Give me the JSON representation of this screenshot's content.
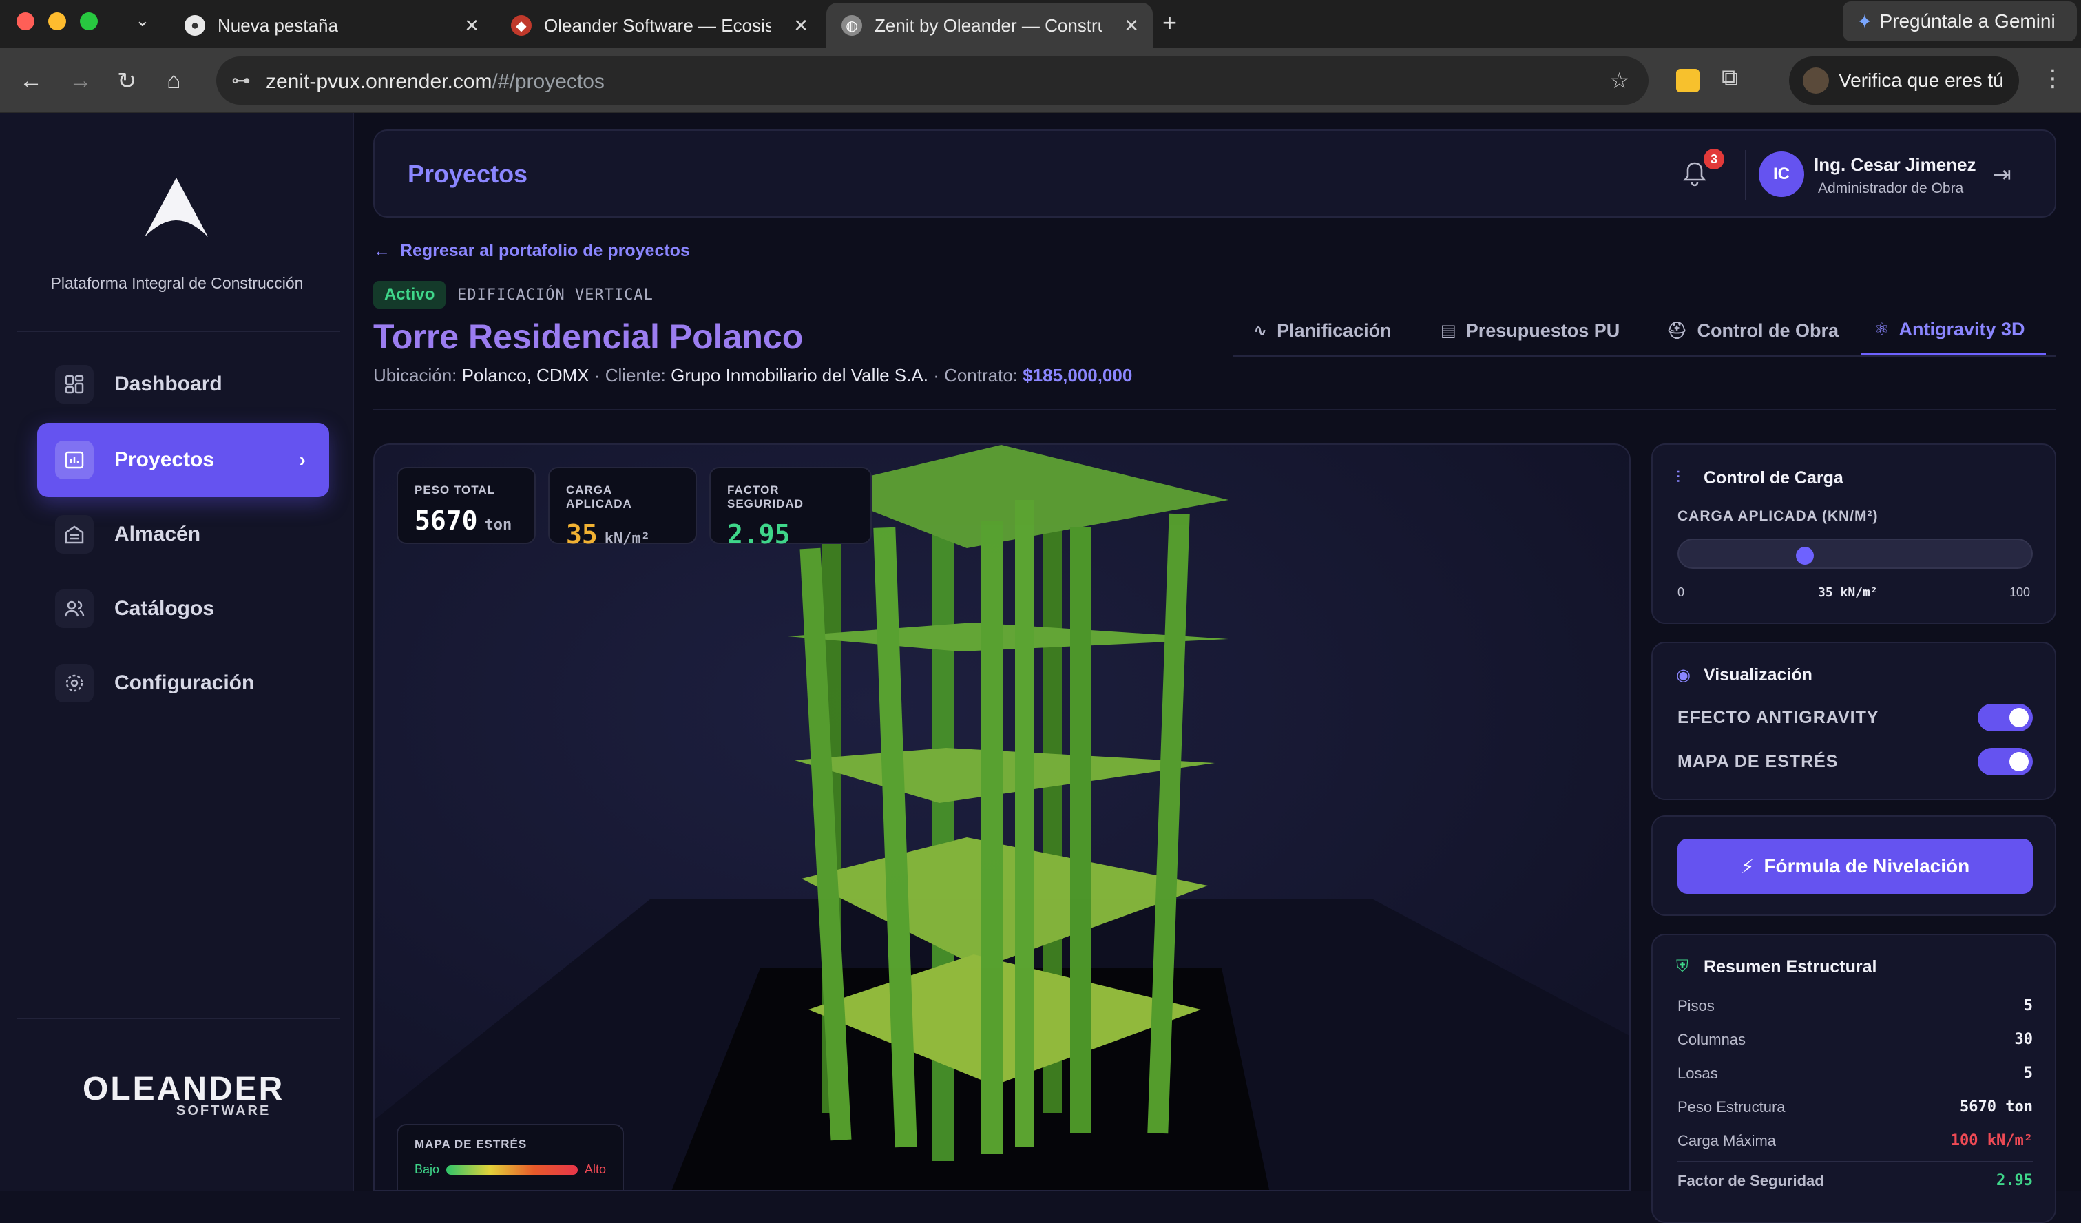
{
  "browser": {
    "tabs": [
      {
        "title": "Nueva pestaña"
      },
      {
        "title": "Oleander Software — Ecosiste"
      },
      {
        "title": "Zenit by Oleander — Construc"
      }
    ],
    "gemini_label": "Pregúntale a Gemini",
    "url_host": "zenit-pvux.onrender.com",
    "url_path": "/#/proyectos",
    "verify_label": "Verifica que eres tú"
  },
  "sidebar": {
    "tagline": "Plataforma Integral de Construcción",
    "items": [
      {
        "label": "Dashboard"
      },
      {
        "label": "Proyectos"
      },
      {
        "label": "Almacén"
      },
      {
        "label": "Catálogos"
      },
      {
        "label": "Configuración"
      }
    ],
    "brand": "OLEANDER",
    "brand_sub": "SOFTWARE"
  },
  "header": {
    "title": "Proyectos",
    "notifications": "3",
    "avatar_initials": "IC",
    "user_name": "Ing. Cesar Jimenez",
    "user_role": "Administrador de Obra"
  },
  "project": {
    "back_label": "Regresar al portafolio de proyectos",
    "status": "Activo",
    "category": "EDIFICACIÓN VERTICAL",
    "title": "Torre Residencial Polanco",
    "location_label": "Ubicación:",
    "location": "Polanco, CDMX",
    "client_label": "· Cliente:",
    "client": "Grupo Inmobiliario del Valle S.A.",
    "contract_label": "· Contrato:",
    "contract": "$185,000,000",
    "tabs": [
      {
        "label": "Planificación"
      },
      {
        "label": "Presupuestos PU"
      },
      {
        "label": "Control de Obra"
      },
      {
        "label": "Antigravity 3D"
      }
    ]
  },
  "viewport": {
    "kpis": [
      {
        "label": "PESO TOTAL",
        "value": "5670",
        "unit": "ton",
        "color": "#ffffff"
      },
      {
        "label": "CARGA APLICADA",
        "value": "35",
        "unit": "kN/m²",
        "color": "#f2b233"
      },
      {
        "label": "FACTOR SEGURIDAD",
        "value": "2.95",
        "color": "#3fd68a"
      }
    ],
    "legend": {
      "title": "MAPA DE ESTRÉS",
      "low": "Bajo",
      "high": "Alto"
    }
  },
  "load_control": {
    "title": "Control de Carga",
    "slider_label": "CARGA APLICADA (KN/M²)",
    "min": "0",
    "max": "100",
    "value_label": "35 kN/m²",
    "value": 0.35
  },
  "visualization": {
    "title": "Visualización",
    "toggles": [
      {
        "label": "EFECTO ANTIGRAVITY",
        "on": true
      },
      {
        "label": "MAPA DE ESTRÉS",
        "on": true
      }
    ]
  },
  "formula_button": "Fórmula de Nivelación",
  "summary": {
    "title": "Resumen Estructural",
    "rows": [
      {
        "label": "Pisos",
        "value": "5"
      },
      {
        "label": "Columnas",
        "value": "30"
      },
      {
        "label": "Losas",
        "value": "5"
      },
      {
        "label": "Peso Estructura",
        "value": "5670 ton"
      },
      {
        "label": "Carga Máxima",
        "value": "100 kN/m²"
      },
      {
        "label": "Factor de Seguridad",
        "value": "2.95"
      }
    ]
  },
  "colors": {
    "accent": "#6553f0",
    "accent_text": "#8b86ff",
    "structure": "#4f9a2a"
  }
}
